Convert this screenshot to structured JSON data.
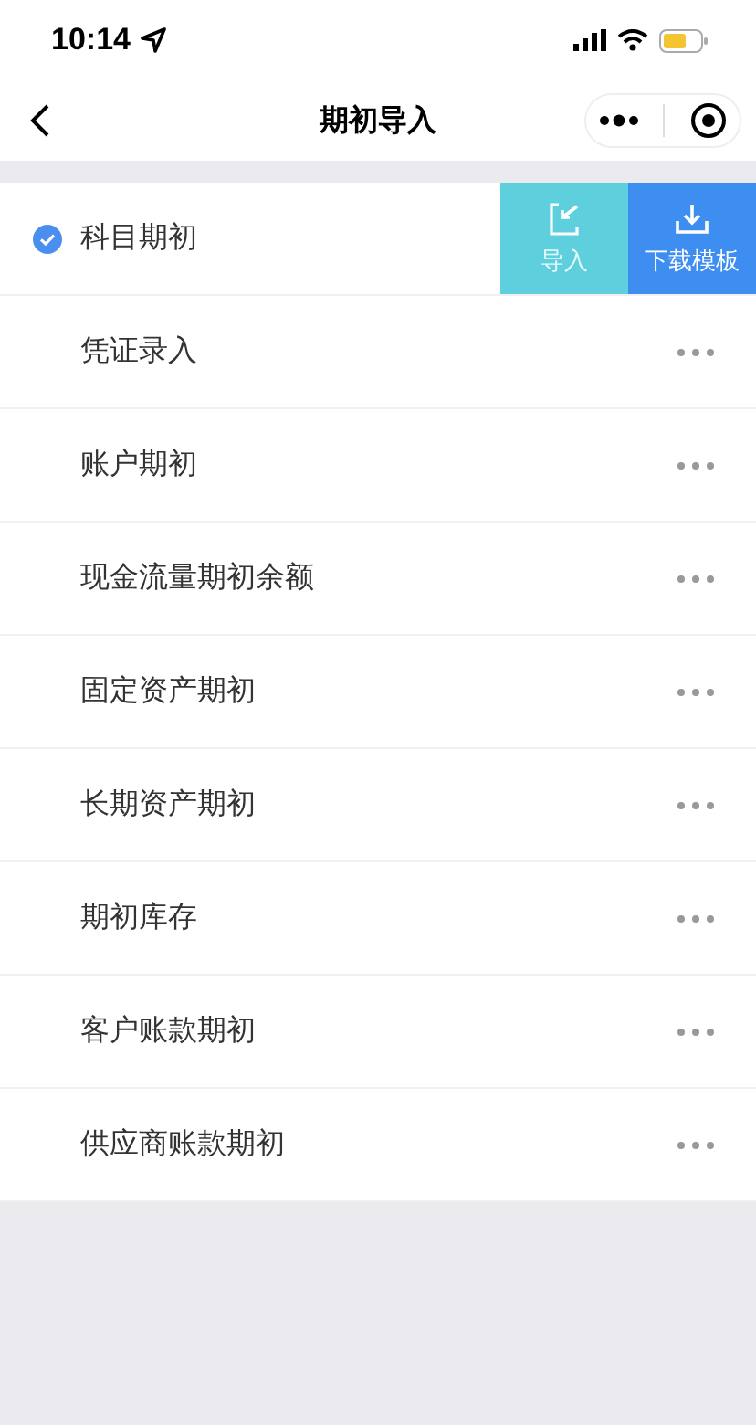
{
  "status_bar": {
    "time": "10:14"
  },
  "nav": {
    "title": "期初导入"
  },
  "items": [
    {
      "label": "科目期初",
      "checked": true,
      "expanded": true
    },
    {
      "label": "凭证录入",
      "checked": false,
      "expanded": false
    },
    {
      "label": "账户期初",
      "checked": false,
      "expanded": false
    },
    {
      "label": "现金流量期初余额",
      "checked": false,
      "expanded": false
    },
    {
      "label": "固定资产期初",
      "checked": false,
      "expanded": false
    },
    {
      "label": "长期资产期初",
      "checked": false,
      "expanded": false
    },
    {
      "label": "期初库存",
      "checked": false,
      "expanded": false
    },
    {
      "label": "客户账款期初",
      "checked": false,
      "expanded": false
    },
    {
      "label": "供应商账款期初",
      "checked": false,
      "expanded": false
    }
  ],
  "actions": [
    {
      "label": "导入",
      "kind": "import"
    },
    {
      "label": "下载模板",
      "kind": "download"
    }
  ]
}
